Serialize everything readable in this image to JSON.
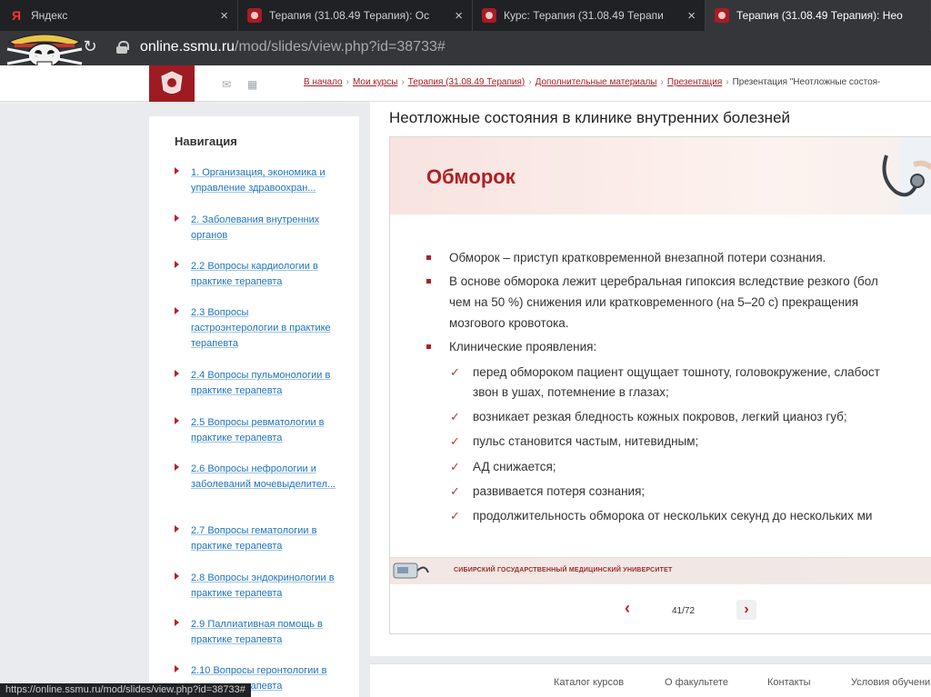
{
  "browser": {
    "tabs": [
      {
        "favicon": "yandex-icon",
        "label": "Яндекс",
        "close": "×",
        "active": false
      },
      {
        "favicon": "crest-icon",
        "label": "Терапия (31.08.49 Терапия): Ос",
        "close": "×",
        "active": false
      },
      {
        "favicon": "crest-icon",
        "label": "Курс: Терапия (31.08.49 Терапи",
        "close": "×",
        "active": false
      },
      {
        "favicon": "crest-icon",
        "label": "Терапия (31.08.49 Терапия): Нео",
        "close": "×",
        "active": true
      }
    ],
    "url_host": "online.ssmu.ru",
    "url_path": "/mod/slides/view.php?id=38733#",
    "status_url": "https://online.ssmu.ru/mod/slides/view.php?id=38733#"
  },
  "header": {
    "icons": [
      "mail-icon",
      "grid-icon"
    ],
    "breadcrumb": [
      {
        "label": "В начало",
        "link": true
      },
      {
        "label": "Мои курсы",
        "link": true
      },
      {
        "label": "Терапия (31.08.49 Терапия)",
        "link": true
      },
      {
        "label": "Дополнительные материалы",
        "link": true
      },
      {
        "label": "Презентация",
        "link": true
      },
      {
        "label": "Презентация \"Неотложные состоя-",
        "link": false
      }
    ],
    "separator": "›"
  },
  "sidebar": {
    "title": "Навигация",
    "items": [
      {
        "label": "1. Организация, экономика и управление здравоохран..."
      },
      {
        "label": "2. Заболевания внутренних органов"
      },
      {
        "label": "2.2 Вопросы кардиологии в практике терапевта"
      },
      {
        "label": "2.3 Вопросы гастроэнтерологии в практике терапевта"
      },
      {
        "label": "2.4 Вопросы пульмонологии в практике терапевта"
      },
      {
        "label": "2.5 Вопросы ревматологии в практике терапевта"
      },
      {
        "label": "2.6 Вопросы нефрологии и заболеваний мочевыделител..."
      },
      {
        "label": "2.7 Вопросы гематологии в практике терапевта"
      },
      {
        "label": "2.8 Вопросы эндокринологии в практике терапевта"
      },
      {
        "label": "2.9 Паллиативная помощь в практике терапевта"
      },
      {
        "label": "2.10 Вопросы геронтологии в практике терапевта"
      }
    ]
  },
  "main": {
    "title": "Неотложные состояния в клинике внутренних болезней",
    "slide": {
      "heading": "Обморок",
      "bullets": [
        {
          "lines": [
            "Обморок – приступ кратковременной внезапной потери сознания."
          ]
        },
        {
          "lines": [
            "В основе обморока лежит церебральная гипоксия вследствие резкого (бол",
            "чем на 50 %) снижения или кратковременного (на 5–20 с) прекращения",
            "мозгового кровотока."
          ]
        },
        {
          "lines": [
            "Клинические проявления:"
          ]
        }
      ],
      "checks": [
        {
          "lines": [
            "перед обмороком пациент ощущает тошноту, головокружение, слабост",
            "звон в ушах, потемнение в глазах;"
          ]
        },
        {
          "lines": [
            "возникает резкая бледность кожных покровов, легкий цианоз губ;"
          ]
        },
        {
          "lines": [
            "пульс становится частым, нитевидным;"
          ]
        },
        {
          "lines": [
            "АД снижается;"
          ]
        },
        {
          "lines": [
            "развивается потеря сознания;"
          ]
        },
        {
          "lines": [
            "продолжительность обморока от нескольких секунд до нескольких ми"
          ]
        }
      ],
      "footer_text": "СИБИРСКИЙ ГОСУДАРСТВЕННЫЙ МЕДИЦИНСКИЙ УНИВЕРСИТЕТ"
    },
    "pager": {
      "prev": "‹",
      "next": "›",
      "current": "41/72"
    }
  },
  "footer": {
    "links": [
      "Каталог курсов",
      "О факультете",
      "Контакты",
      "Условия обучени"
    ]
  },
  "colors": {
    "accent": "#b01e26",
    "link": "#1e73be",
    "chrome": "#35363a"
  }
}
